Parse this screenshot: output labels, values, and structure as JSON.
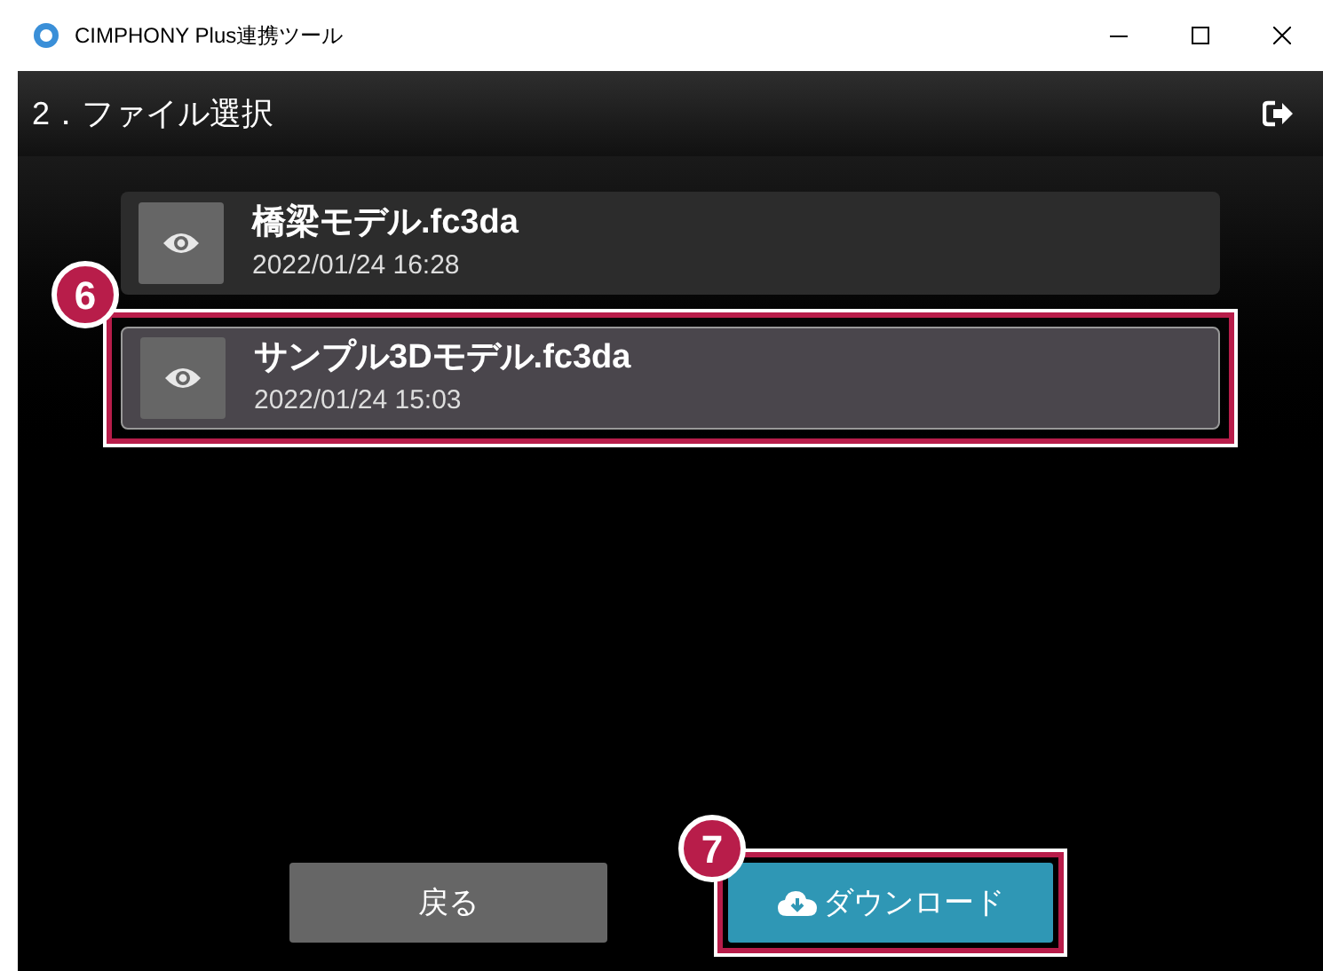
{
  "window": {
    "title": "CIMPHONY Plus連携ツール"
  },
  "header": {
    "title": "2．ファイル選択"
  },
  "files": [
    {
      "name": "橋梁モデル.fc3da",
      "date": "2022/01/24 16:28",
      "selected": false
    },
    {
      "name": "サンプル3Dモデル.fc3da",
      "date": "2022/01/24 15:03",
      "selected": true,
      "callout": "6"
    }
  ],
  "buttons": {
    "back": "戻る",
    "download": "ダウンロード",
    "download_callout": "7"
  }
}
